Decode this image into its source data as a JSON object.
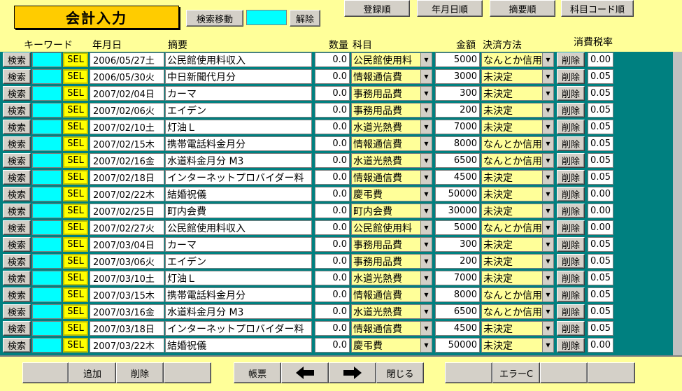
{
  "header": {
    "title": "会計入力",
    "search_move_label": "検索移動",
    "clear_label": "解除",
    "sort_buttons": [
      "登録順",
      "年月日順",
      "摘要順",
      "科目コード順"
    ]
  },
  "columns": {
    "keyword": "キーワード",
    "date": "年月日",
    "description": "摘要",
    "quantity": "数量",
    "account": "科目",
    "amount": "金額",
    "payment": "決済方法",
    "tax_rate": "消費税率"
  },
  "row_labels": {
    "search": "検索",
    "sel": "SEL",
    "delete": "削除"
  },
  "rows": [
    {
      "date": "2006/05/27土",
      "desc": "公民館使用料収入",
      "qty": "0.0",
      "acct": "公民館使用料",
      "amt": "5000",
      "pay": "なんとか信用",
      "tax": "0.00"
    },
    {
      "date": "2006/05/30火",
      "desc": "中日新聞代月分",
      "qty": "0.0",
      "acct": "情報通信費",
      "amt": "3000",
      "pay": "未決定",
      "tax": "0.05"
    },
    {
      "date": "2007/02/04日",
      "desc": "カーマ",
      "qty": "0.0",
      "acct": "事務用品費",
      "amt": "300",
      "pay": "未決定",
      "tax": "0.05"
    },
    {
      "date": "2007/02/06火",
      "desc": "エイデン",
      "qty": "0.0",
      "acct": "事務用品費",
      "amt": "200",
      "pay": "未決定",
      "tax": "0.05"
    },
    {
      "date": "2007/02/10土",
      "desc": "灯油Ｌ",
      "qty": "0.0",
      "acct": "水道光熱費",
      "amt": "7000",
      "pay": "未決定",
      "tax": "0.05"
    },
    {
      "date": "2007/02/15木",
      "desc": "携帯電話料金月分",
      "qty": "0.0",
      "acct": "情報通信費",
      "amt": "8000",
      "pay": "なんとか信用",
      "tax": "0.05"
    },
    {
      "date": "2007/02/16金",
      "desc": "水道料金月分 M3",
      "qty": "0.0",
      "acct": "水道光熱費",
      "amt": "6500",
      "pay": "なんとか信用",
      "tax": "0.05"
    },
    {
      "date": "2007/02/18日",
      "desc": "インターネットプロバイダー料",
      "qty": "0.0",
      "acct": "情報通信費",
      "amt": "4500",
      "pay": "未決定",
      "tax": "0.05"
    },
    {
      "date": "2007/02/22木",
      "desc": "結婚祝儀",
      "qty": "0.0",
      "acct": "慶弔費",
      "amt": "50000",
      "pay": "未決定",
      "tax": "0.00"
    },
    {
      "date": "2007/02/25日",
      "desc": "町内会費",
      "qty": "0.0",
      "acct": "町内会費",
      "amt": "30000",
      "pay": "未決定",
      "tax": "0.00"
    },
    {
      "date": "2007/02/27火",
      "desc": "公民館使用料収入",
      "qty": "0.0",
      "acct": "公民館使用料",
      "amt": "5000",
      "pay": "なんとか信用",
      "tax": "0.00"
    },
    {
      "date": "2007/03/04日",
      "desc": "カーマ",
      "qty": "0.0",
      "acct": "事務用品費",
      "amt": "300",
      "pay": "未決定",
      "tax": "0.05"
    },
    {
      "date": "2007/03/06火",
      "desc": "エイデン",
      "qty": "0.0",
      "acct": "事務用品費",
      "amt": "200",
      "pay": "未決定",
      "tax": "0.05"
    },
    {
      "date": "2007/03/10土",
      "desc": "灯油Ｌ",
      "qty": "0.0",
      "acct": "水道光熱費",
      "amt": "7000",
      "pay": "未決定",
      "tax": "0.05"
    },
    {
      "date": "2007/03/15木",
      "desc": "携帯電話料金月分",
      "qty": "0.0",
      "acct": "情報通信費",
      "amt": "8000",
      "pay": "なんとか信用",
      "tax": "0.05"
    },
    {
      "date": "2007/03/16金",
      "desc": "水道料金月分 M3",
      "qty": "0.0",
      "acct": "水道光熱費",
      "amt": "6500",
      "pay": "なんとか信用",
      "tax": "0.05"
    },
    {
      "date": "2007/03/18日",
      "desc": "インターネットプロバイダー料",
      "qty": "0.0",
      "acct": "情報通信費",
      "amt": "4500",
      "pay": "未決定",
      "tax": "0.05"
    },
    {
      "date": "2007/03/22木",
      "desc": "結婚祝儀",
      "qty": "0.0",
      "acct": "慶弔費",
      "amt": "50000",
      "pay": "未決定",
      "tax": "0.00"
    }
  ],
  "footer": {
    "add_label": "追加",
    "delete_label": "削除",
    "ledger_label": "帳票",
    "prev_icon": "left-arrow-icon",
    "next_icon": "right-arrow-icon",
    "close_label": "閉じる",
    "error_clear_label": "エラーC"
  }
}
